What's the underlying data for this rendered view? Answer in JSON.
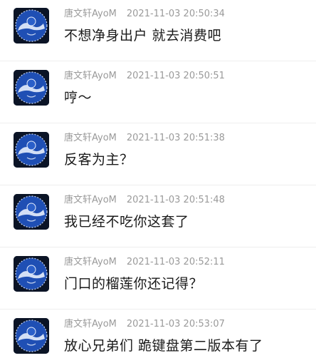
{
  "comments": [
    {
      "user": "唐文轩AyoM",
      "time": "2021-11-03 20:50:34",
      "text": "不想净身出户  就去消费吧"
    },
    {
      "user": "唐文轩AyoM",
      "time": "2021-11-03 20:50:51",
      "text": "哼～"
    },
    {
      "user": "唐文轩AyoM",
      "time": "2021-11-03 20:51:38",
      "text": "反客为主？"
    },
    {
      "user": "唐文轩AyoM",
      "time": "2021-11-03 20:51:48",
      "text": "我已经不吃你这套了"
    },
    {
      "user": "唐文轩AyoM",
      "time": "2021-11-03 20:52:11",
      "text": "门口的榴莲你还记得？"
    },
    {
      "user": "唐文轩AyoM",
      "time": "2021-11-03 20:53:07",
      "text": "放心兄弟们  跪键盘第二版本有了"
    }
  ],
  "colors": {
    "username": "#9a9a9a",
    "message": "#1a1a1a",
    "avatar_bg": "#0b1426",
    "avatar_disc": "#1f4fb4"
  }
}
